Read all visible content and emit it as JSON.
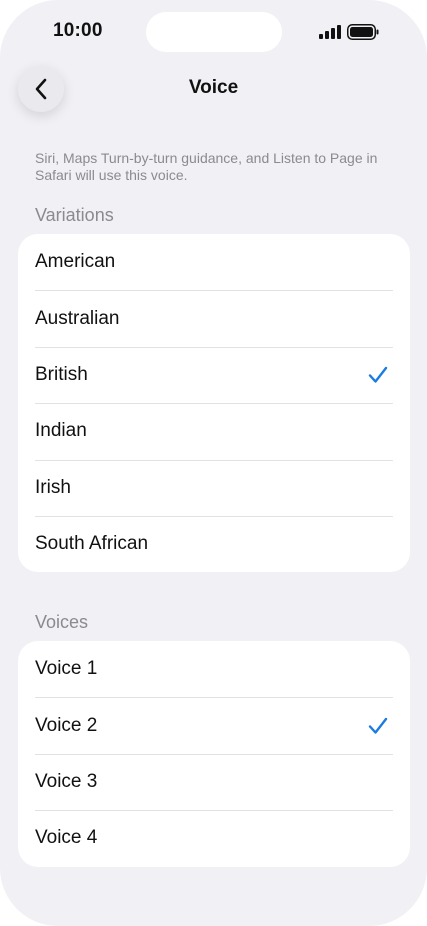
{
  "status_bar": {
    "time": "10:00"
  },
  "nav": {
    "title": "Voice",
    "back_icon": "chevron-left-icon"
  },
  "description": "Siri, Maps Turn-by-turn guidance, and Listen to Page in Safari will use this voice.",
  "variations": {
    "header": "Variations",
    "items": [
      {
        "label": "American",
        "selected": false
      },
      {
        "label": "Australian",
        "selected": false
      },
      {
        "label": "British",
        "selected": true
      },
      {
        "label": "Indian",
        "selected": false
      },
      {
        "label": "Irish",
        "selected": false
      },
      {
        "label": "South African",
        "selected": false
      }
    ]
  },
  "voices": {
    "header": "Voices",
    "items": [
      {
        "label": "Voice 1",
        "selected": false
      },
      {
        "label": "Voice 2",
        "selected": true
      },
      {
        "label": "Voice 3",
        "selected": false
      },
      {
        "label": "Voice 4",
        "selected": false
      }
    ]
  },
  "colors": {
    "background": "#f1f0f5",
    "card": "#ffffff",
    "accent": "#1a7be0",
    "secondary_text": "#8a8a8f"
  }
}
